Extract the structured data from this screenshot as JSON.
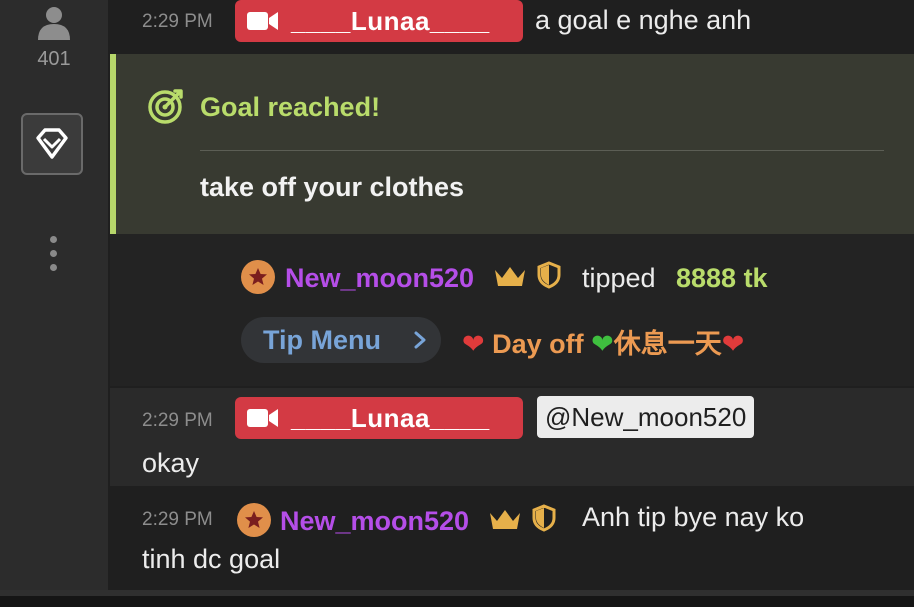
{
  "sidebar": {
    "viewer_count": "401",
    "viewer_icon": "user-icon",
    "token_icon": "diamond-icon",
    "more_icon": "vertical-dots-icon"
  },
  "messages": [
    {
      "time": "2:29 PM",
      "user": "____Lunaa____",
      "role": "model",
      "text": "a goal e nghe anh"
    },
    {
      "time": "2:29 PM",
      "user": "____Lunaa____",
      "role": "model",
      "mention": "@New_moon520",
      "text": "okay"
    },
    {
      "time": "2:29 PM",
      "user": "New_moon520",
      "role": "member",
      "text_line1": "Anh tip bye nay ko",
      "text_line2": "tinh dc goal"
    }
  ],
  "goal": {
    "title": "Goal reached!",
    "text": "take off your clothes",
    "icon": "target-icon"
  },
  "tip": {
    "user": "New_moon520",
    "verb": "tipped",
    "amount": "8888 tk",
    "menu_label": "Tip Menu",
    "item_prefix": "Day off",
    "item_suffix": "休息一天"
  },
  "colors": {
    "model_badge": "#d33a44",
    "goal_accent": "#b9dc6b",
    "member_name": "#b54ee8",
    "tip_menu_text": "#78a4d8",
    "tip_item": "#ec9a52",
    "crown": "#e6b04a"
  }
}
